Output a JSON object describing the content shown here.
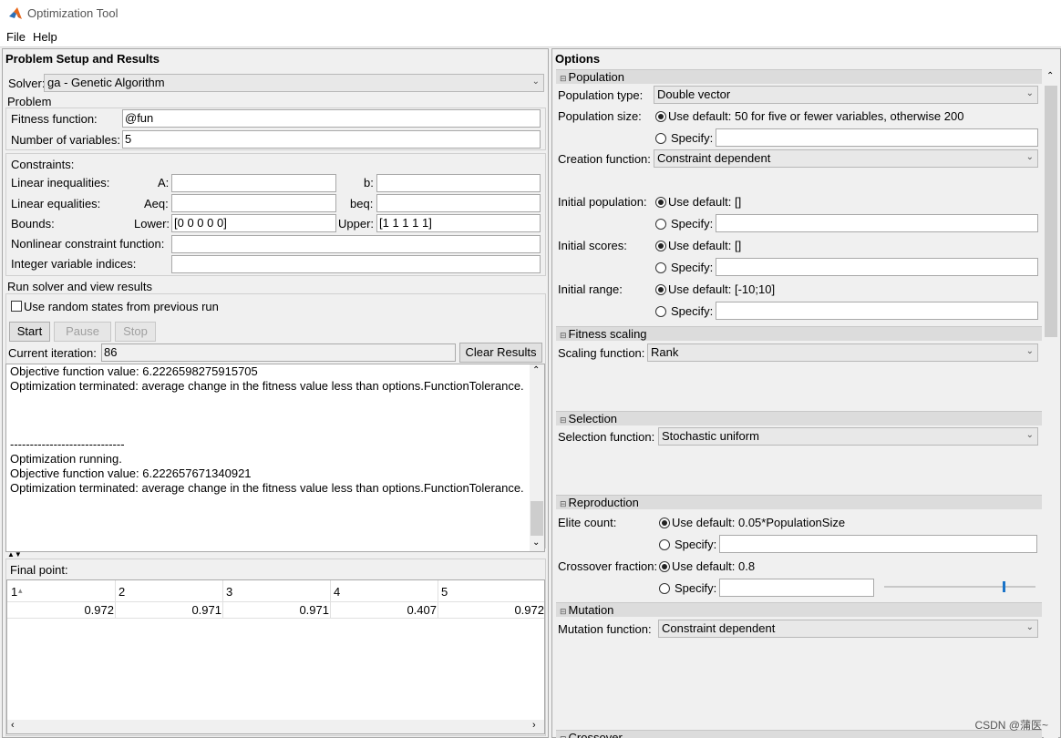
{
  "window": {
    "title": "Optimization Tool"
  },
  "menu": [
    "File",
    "Help"
  ],
  "left": {
    "title": "Problem Setup and Results",
    "solver_label": "Solver:",
    "solver_value": "ga - Genetic Algorithm",
    "problem_label": "Problem",
    "fitness_label": "Fitness function:",
    "fitness_value": "@fun",
    "numvars_label": "Number of variables:",
    "numvars_value": "5",
    "constraints_label": "Constraints:",
    "lin_ineq_label": "Linear inequalities:",
    "a_label": "A:",
    "b_label": "b:",
    "lin_eq_label": "Linear equalities:",
    "aeq_label": "Aeq:",
    "beq_label": "beq:",
    "bounds_label": "Bounds:",
    "lower_label": "Lower:",
    "lower_value": "[0 0 0 0 0]",
    "upper_label": "Upper:",
    "upper_value": "[1 1 1 1 1]",
    "nonlin_label": "Nonlinear constraint function:",
    "intvar_label": "Integer variable indices:",
    "run_label": "Run solver and view results",
    "random_states_label": "Use random states from previous run",
    "start_label": "Start",
    "pause_label": "Pause",
    "stop_label": "Stop",
    "current_iter_label": "Current iteration:",
    "current_iter_value": "86",
    "clear_label": "Clear Results",
    "output_lines": [
      "Objective function value: 6.2226598275915705",
      "Optimization terminated: average change in the fitness value less than options.FunctionTolerance.",
      "",
      "",
      "",
      "-----------------------------",
      "Optimization running.",
      "Objective function value: 6.222657671340921",
      "Optimization terminated: average change in the fitness value less than options.FunctionTolerance."
    ],
    "final_point_label": "Final point:",
    "final_point_headers": [
      "1",
      "2",
      "3",
      "4",
      "5"
    ],
    "final_point_values": [
      "0.972",
      "0.971",
      "0.971",
      "0.407",
      "0.972"
    ]
  },
  "right": {
    "title": "Options",
    "population": {
      "section": "Population",
      "type_label": "Population type:",
      "type_value": "Double vector",
      "size_label": "Population size:",
      "size_default": "Use default: 50 for five or fewer variables, otherwise 200",
      "specify": "Specify:",
      "creation_label": "Creation function:",
      "creation_value": "Constraint dependent",
      "init_pop_label": "Initial population:",
      "init_pop_default": "Use default: []",
      "init_scores_label": "Initial scores:",
      "init_scores_default": "Use default: []",
      "init_range_label": "Initial range:",
      "init_range_default": "Use default: [-10;10]"
    },
    "fitness_scaling": {
      "section": "Fitness scaling",
      "label": "Scaling function:",
      "value": "Rank"
    },
    "selection": {
      "section": "Selection",
      "label": "Selection function:",
      "value": "Stochastic uniform"
    },
    "reproduction": {
      "section": "Reproduction",
      "elite_label": "Elite count:",
      "elite_default": "Use default: 0.05*PopulationSize",
      "crossover_label": "Crossover fraction:",
      "crossover_default": "Use default: 0.8",
      "specify": "Specify:"
    },
    "mutation": {
      "section": "Mutation",
      "label": "Mutation function:",
      "value": "Constraint dependent"
    },
    "crossover": {
      "section": "Crossover"
    }
  },
  "watermark": "CSDN @蒲医~"
}
